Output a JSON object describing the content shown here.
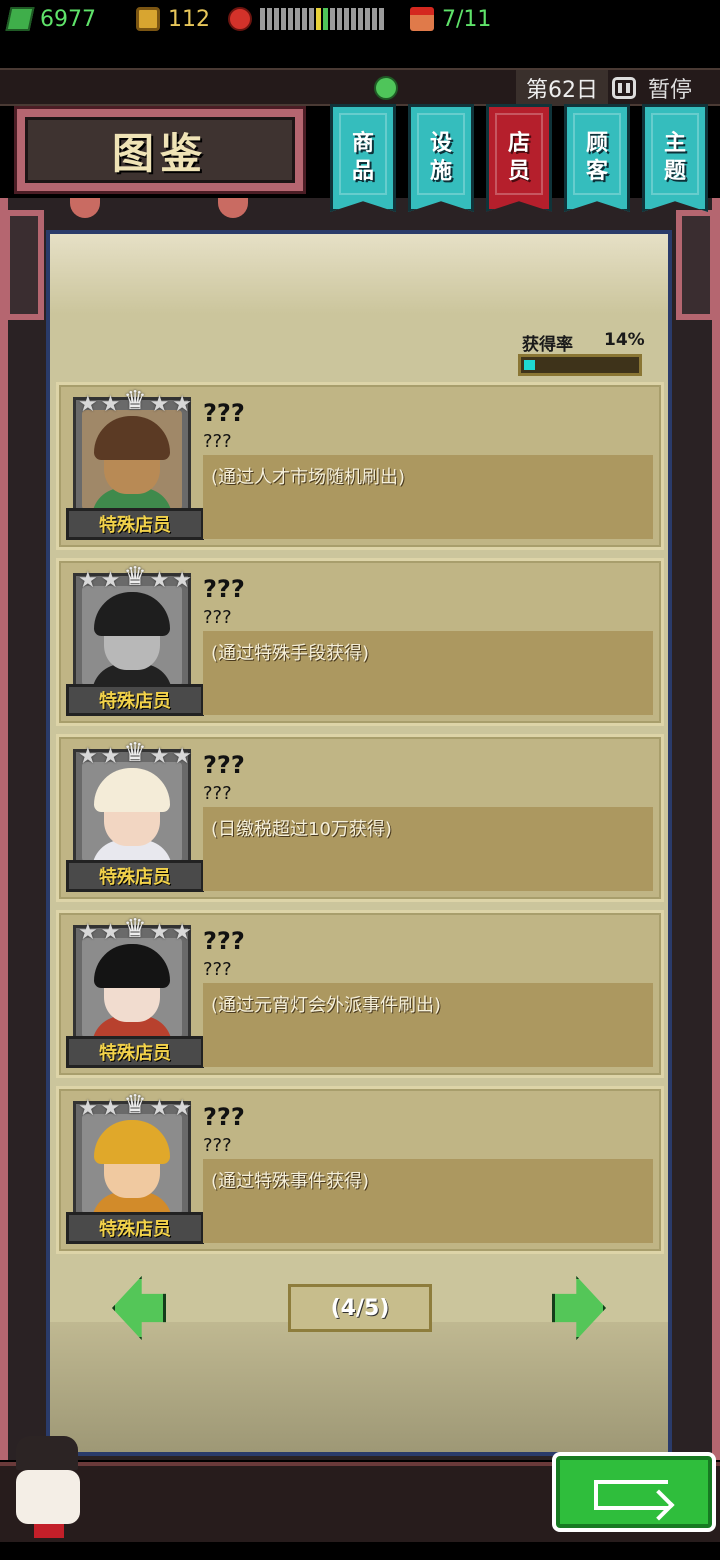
{
  "status": {
    "money": "6977",
    "coins": "112",
    "staff": "7/11",
    "day": "第62日",
    "pause_label": "暂停",
    "mood_level": 0.55
  },
  "title": "图鉴",
  "tabs": [
    {
      "label_line1": "商",
      "label_line2": "品",
      "active": false
    },
    {
      "label_line1": "设",
      "label_line2": "施",
      "active": false
    },
    {
      "label_line1": "店",
      "label_line2": "员",
      "active": true
    },
    {
      "label_line1": "顾",
      "label_line2": "客",
      "active": false
    },
    {
      "label_line1": "主",
      "label_line2": "题",
      "active": false
    }
  ],
  "acquisition": {
    "label": "获得率",
    "value_text": "14%",
    "value": 0.14
  },
  "cards": [
    {
      "name": "???",
      "sub": "???",
      "badge": "特殊店员",
      "desc": "(通过人才市场随机刷出)",
      "stars": 5,
      "portrait": {
        "hair": "#5b3a24",
        "skin": "#b88a55",
        "body": "#3f8a4c",
        "bg": "#a08868"
      }
    },
    {
      "name": "???",
      "sub": "???",
      "badge": "特殊店员",
      "desc": "(通过特殊手段获得)",
      "stars": 5,
      "portrait": {
        "hair": "#1e1e1e",
        "skin": "#b8b8b8",
        "body": "#222222",
        "bg": "#8c8c8c"
      }
    },
    {
      "name": "???",
      "sub": "???",
      "badge": "特殊店员",
      "desc": "(日缴税超过10万获得)",
      "stars": 5,
      "portrait": {
        "hair": "#f4ecd8",
        "skin": "#f2d6c2",
        "body": "#e8e8ee",
        "bg": "#8c8c8c"
      }
    },
    {
      "name": "???",
      "sub": "???",
      "badge": "特殊店员",
      "desc": "(通过元宵灯会外派事件刷出)",
      "stars": 5,
      "portrait": {
        "hair": "#141414",
        "skin": "#f1dccf",
        "body": "#b8412e",
        "bg": "#8c8c8c"
      }
    },
    {
      "name": "???",
      "sub": "???",
      "badge": "特殊店员",
      "desc": "(通过特殊事件获得)",
      "stars": 5,
      "portrait": {
        "hair": "#e0a82a",
        "skin": "#f0c9a0",
        "body": "#d28b2a",
        "bg": "#8c8c8c"
      }
    }
  ],
  "pager": {
    "text": "(4/5)"
  },
  "colors": {
    "tab_active": "#b51f2c",
    "tab_inactive": "#35bdbd",
    "confirm_button": "#2fbe3c"
  }
}
